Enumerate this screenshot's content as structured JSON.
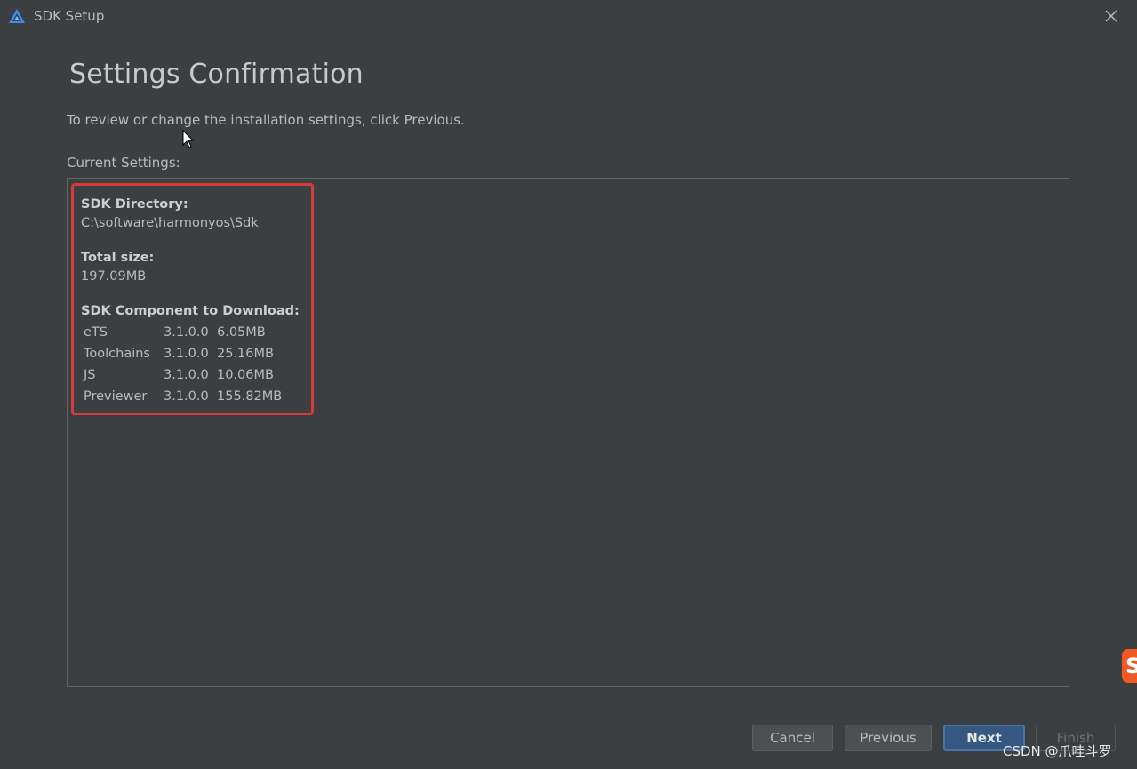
{
  "window": {
    "title": "SDK Setup",
    "app_icon": "harmony-triangle-icon",
    "close_icon": "close-icon"
  },
  "page": {
    "title": "Settings Confirmation",
    "instruction": "To review or change the installation settings, click Previous.",
    "current_settings_label": "Current Settings:"
  },
  "settings": {
    "sdk_directory_label": "SDK Directory:",
    "sdk_directory_value": "C:\\software\\harmonyos\\Sdk",
    "total_size_label": "Total size:",
    "total_size_value": "197.09MB",
    "components_label": "SDK Component to Download:",
    "components": [
      {
        "name": "eTS",
        "version": "3.1.0.0",
        "size": "6.05MB"
      },
      {
        "name": "Toolchains",
        "version": "3.1.0.0",
        "size": "25.16MB"
      },
      {
        "name": "JS",
        "version": "3.1.0.0",
        "size": "10.06MB"
      },
      {
        "name": "Previewer",
        "version": "3.1.0.0",
        "size": "155.82MB"
      }
    ]
  },
  "buttons": {
    "cancel": "Cancel",
    "previous": "Previous",
    "next": "Next",
    "finish": "Finish"
  },
  "badge": {
    "letter": "S"
  },
  "watermark": "CSDN @爪哇斗罗",
  "colors": {
    "background": "#3c3f41",
    "highlight_border": "#d73a3a",
    "primary_button": "#365880",
    "badge": "#f05a22"
  }
}
